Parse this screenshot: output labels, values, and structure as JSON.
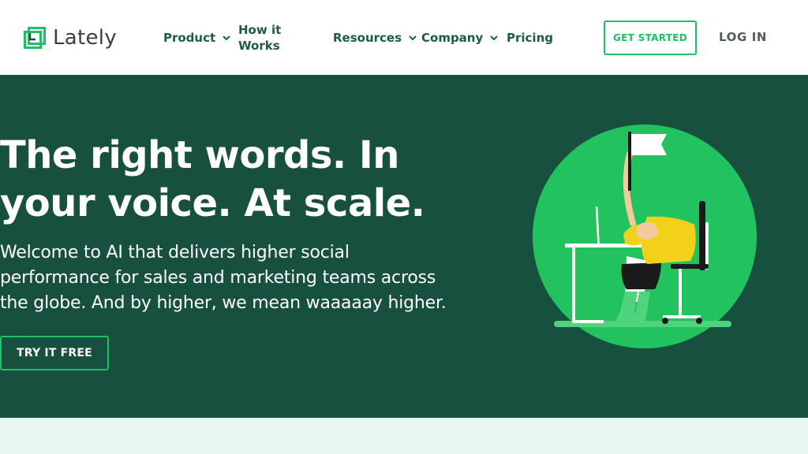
{
  "brand": {
    "name": "Lately",
    "accent": "#1fbf63",
    "dark": "#18503f"
  },
  "nav": {
    "product": "Product",
    "how_it_works": [
      "How it",
      "Works"
    ],
    "resources": "Resources",
    "company": "Company",
    "pricing": "Pricing",
    "dropdown_icon": "chevron-down-icon"
  },
  "header_actions": {
    "get_started": "GET STARTED",
    "log_in": "LOG IN"
  },
  "hero": {
    "title_line1": "The right words. In",
    "title_line2": "your voice. At scale.",
    "sub_line1": "Welcome to AI that delivers higher social",
    "sub_line2": "performance for sales and marketing teams across",
    "sub_line3": "the globe. And by higher, we mean waaaaay higher.",
    "cta": "TRY IT FREE",
    "illustration": "person-at-desk-waving-white-flag"
  },
  "colors": {
    "light_band": "#e9f7f1",
    "circle": "#22c35e",
    "nav_text": "#1d5c45"
  }
}
